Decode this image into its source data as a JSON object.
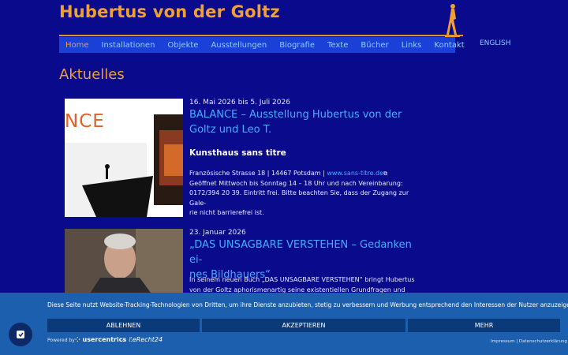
{
  "header": {
    "title": "Hubertus von der Goltz",
    "lang_link": "ENGLISH"
  },
  "nav": [
    {
      "label": "Home",
      "active": true
    },
    {
      "label": "Installationen"
    },
    {
      "label": "Objekte"
    },
    {
      "label": "Ausstellungen"
    },
    {
      "label": "Biografie"
    },
    {
      "label": "Texte"
    },
    {
      "label": "Bücher"
    },
    {
      "label": "Links"
    },
    {
      "label": "Kontakt"
    }
  ],
  "section_title": "Aktuelles",
  "posts": [
    {
      "date": "16. Mai 2026 bis 5. Juli 2026",
      "title_line1": "BALANCE – Ausstellung Hubertus von der",
      "title_line2": "Goltz und Leo T.",
      "subtitle": "Kunsthaus sans titre",
      "image_text": "NCE",
      "body_1a": "Französische Strasse 18 | 14467 Potsdam | ",
      "body_1_link": "www.sans-titre.de",
      "body_2": "Geöffnet Mittwoch bis Sonntag 14 – 18 Uhr und nach Vereinbarung:",
      "body_3": "0172/394 20 39. Eintritt frei. Bitte beachten Sie, dass der Zugang zur Gale-",
      "body_4": "rie nicht barrierefrei ist."
    },
    {
      "date": "23. Januar 2026",
      "title_line1": "„DAS UNSAGBARE VERSTEHEN – Gedanken ei-",
      "title_line2": "nes Bildhauers“",
      "body_1": "In seinem neuen Buch „DAS UNSAGBARE VERSTEHEN“ bringt Hubertus",
      "body_2": "von der Goltz aphorismenartig seine existentiellen Grundfragen und"
    }
  ],
  "cookie": {
    "text": "Diese Seite nutzt Website-Tracking-Technologien von Dritten, um ihre Dienste anzubieten, stetig zu verbessern und Werbung entsprechend den Interessen der Nutzer anzuzeigen.",
    "deny": "ABLEHNEN",
    "accept": "AKZEPTIEREN",
    "more": "MEHR",
    "powered": "Powered by",
    "brand1": "usercentrics",
    "amp": "&",
    "brand2": "eRecht24",
    "imprint": "Impressum | Datenschutzerklärung"
  },
  "colors": {
    "background": "#0a0a8c",
    "accent": "#f0a030",
    "nav": "#1a40d8",
    "link": "#3fb0ff",
    "cookie_bar": "#1b5fae"
  }
}
